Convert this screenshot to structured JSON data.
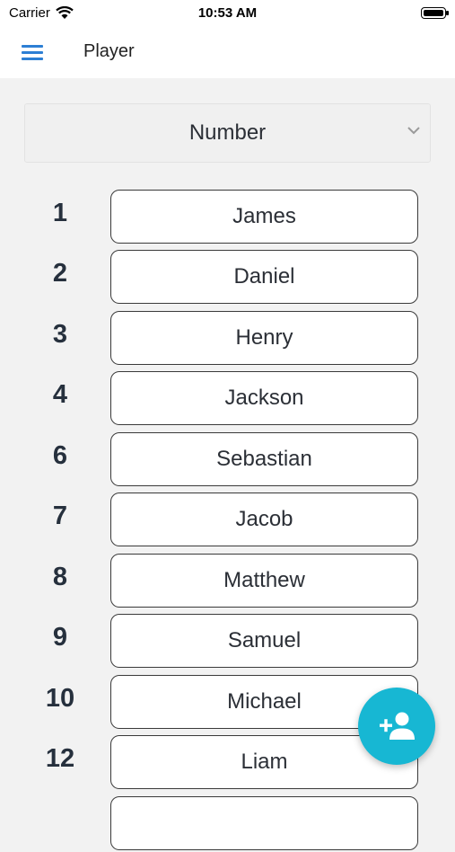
{
  "status_bar": {
    "carrier": "Carrier",
    "time": "10:53 AM"
  },
  "app_bar": {
    "title": "Player",
    "menu_icon": "hamburger-menu-icon"
  },
  "sort_select": {
    "selected": "Number",
    "icon": "chevron-down-icon"
  },
  "players": [
    {
      "number": "1",
      "name": "James"
    },
    {
      "number": "2",
      "name": "Daniel"
    },
    {
      "number": "3",
      "name": "Henry"
    },
    {
      "number": "4",
      "name": "Jackson"
    },
    {
      "number": "6",
      "name": "Sebastian"
    },
    {
      "number": "7",
      "name": "Jacob"
    },
    {
      "number": "8",
      "name": "Matthew"
    },
    {
      "number": "9",
      "name": "Samuel"
    },
    {
      "number": "10",
      "name": "Michael"
    },
    {
      "number": "12",
      "name": "Liam"
    },
    {
      "number": "",
      "name": ""
    }
  ],
  "fab": {
    "icon": "add-person-icon",
    "color": "#17b7d3"
  },
  "colors": {
    "accent": "#2d7fd4",
    "fab": "#17b7d3",
    "background": "#f2f2f2"
  }
}
